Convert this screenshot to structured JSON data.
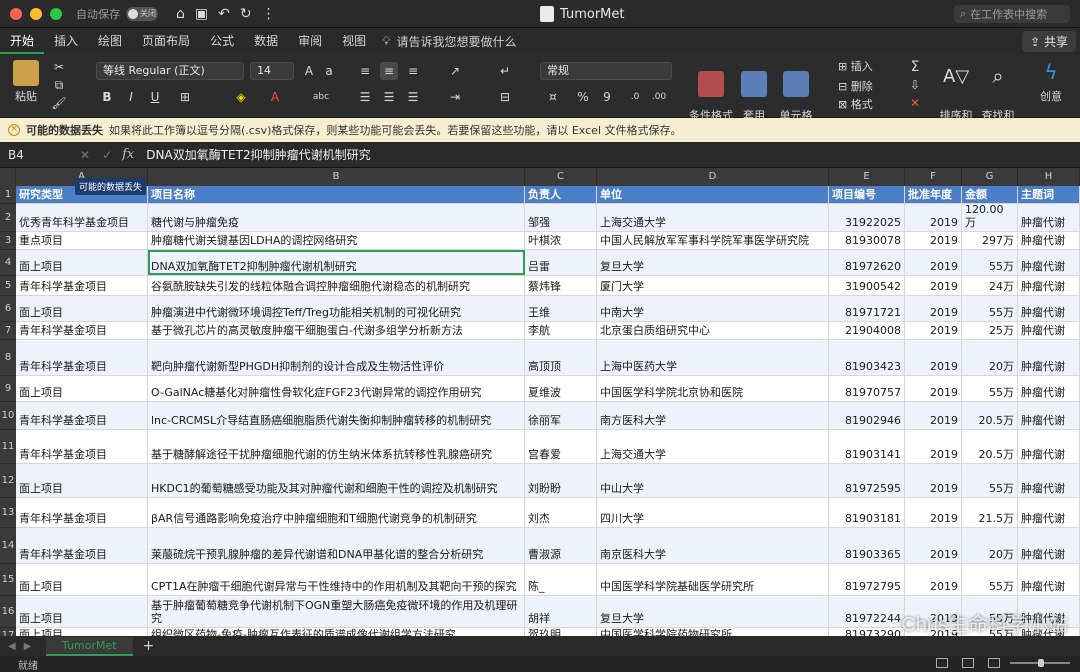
{
  "window": {
    "title": "TumorMet",
    "autosave_label": "自动保存",
    "autosave_state": "关闭",
    "search_placeholder": "在工作表中搜索"
  },
  "tabs": [
    "开始",
    "插入",
    "绘图",
    "页面布局",
    "公式",
    "数据",
    "审阅",
    "视图"
  ],
  "tell_me": "请告诉我您想要做什么",
  "share_label": "共享",
  "ribbon": {
    "paste_label": "粘贴",
    "font_name": "等线 Regular (正文)",
    "font_size": "14",
    "number_format": "常规",
    "conditional_format": "条件格式",
    "table_format": "套用\n表格格式",
    "cell_style": "单元格\n样式",
    "insert": "插入",
    "delete": "删除",
    "format": "格式",
    "sort_filter": "排序和\n筛选",
    "find_select": "查找和\n选择",
    "create": "创意"
  },
  "warning": {
    "title": "可能的数据丢失",
    "message": "如果将此工作簿以逗号分隔(.csv)格式保存，则某些功能可能会丢失。若要保留这些功能，请以 Excel 文件格式保存。"
  },
  "formula_bar": {
    "name_box": "B4",
    "formula": "DNA双加氧酶TET2抑制肿瘤代谢机制研究"
  },
  "tooltip": "可能的数据丢失",
  "columns": [
    "A",
    "B",
    "C",
    "D",
    "E",
    "F",
    "G",
    "H"
  ],
  "header": [
    "研究类型",
    "项目名称",
    "负责人",
    "单位",
    "项目编号",
    "批准年度",
    "金额",
    "主题词"
  ],
  "rows": [
    {
      "n": "2",
      "a": "优秀青年科学基金项目",
      "b": "糖代谢与肿瘤免疫",
      "c": "邹强",
      "d": "上海交通大学",
      "e": "31922025",
      "f": "2019",
      "g": "120.00万",
      "h": "肿瘤代谢"
    },
    {
      "n": "3",
      "a": "重点项目",
      "b": "肿瘤糖代谢关键基因LDHA的调控网络研究",
      "c": "叶棋浓",
      "d": "中国人民解放军军事科学院军事医学研究院",
      "e": "81930078",
      "f": "2019",
      "g": "297万",
      "h": "肿瘤代谢"
    },
    {
      "n": "4",
      "a": "面上项目",
      "b": "DNA双加氧酶TET2抑制肿瘤代谢机制研究",
      "c": "吕雷",
      "d": "复旦大学",
      "e": "81972620",
      "f": "2019",
      "g": "55万",
      "h": "肿瘤代谢"
    },
    {
      "n": "5",
      "a": "青年科学基金项目",
      "b": "谷氨酰胺缺失引发的线粒体融合调控肿瘤细胞代谢稳态的机制研究",
      "c": "蔡炜锋",
      "d": "厦门大学",
      "e": "31900542",
      "f": "2019",
      "g": "24万",
      "h": "肿瘤代谢"
    },
    {
      "n": "6",
      "a": "面上项目",
      "b": "肿瘤演进中代谢微环境调控Teff/Treg功能相关机制的可视化研究",
      "c": "王维",
      "d": "中南大学",
      "e": "81971721",
      "f": "2019",
      "g": "55万",
      "h": "肿瘤代谢"
    },
    {
      "n": "7",
      "a": "青年科学基金项目",
      "b": "基于微孔芯片的高灵敏度肿瘤干细胞蛋白-代谢多组学分析新方法",
      "c": "李航",
      "d": "北京蛋白质组研究中心",
      "e": "21904008",
      "f": "2019",
      "g": "25万",
      "h": "肿瘤代谢"
    },
    {
      "n": "8",
      "a": "青年科学基金项目",
      "b": "靶向肿瘤代谢新型PHGDH抑制剂的设计合成及生物活性评价",
      "c": "高顶顶",
      "d": "上海中医药大学",
      "e": "81903423",
      "f": "2019",
      "g": "20万",
      "h": "肿瘤代谢"
    },
    {
      "n": "9",
      "a": "面上项目",
      "b": "O-GalNAc糖基化对肿瘤性骨软化症FGF23代谢异常的调控作用研究",
      "c": "夏维波",
      "d": "中国医学科学院北京协和医院",
      "e": "81970757",
      "f": "2019",
      "g": "55万",
      "h": "肿瘤代谢"
    },
    {
      "n": "10",
      "a": "青年科学基金项目",
      "b": "lnc-CRCMSL介导结直肠癌细胞脂质代谢失衡抑制肿瘤转移的机制研究",
      "c": "徐丽军",
      "d": "南方医科大学",
      "e": "81902946",
      "f": "2019",
      "g": "20.5万",
      "h": "肿瘤代谢"
    },
    {
      "n": "11",
      "a": "青年科学基金项目",
      "b": "基于糖酵解途径干扰肿瘤细胞代谢的仿生纳米体系抗转移性乳腺癌研究",
      "c": "宫春爱",
      "d": "上海交通大学",
      "e": "81903141",
      "f": "2019",
      "g": "20.5万",
      "h": "肿瘤代谢"
    },
    {
      "n": "12",
      "a": "面上项目",
      "b": "HKDC1的葡萄糖感受功能及其对肿瘤代谢和细胞干性的调控及机制研究",
      "c": "刘盼盼",
      "d": "中山大学",
      "e": "81972595",
      "f": "2019",
      "g": "55万",
      "h": "肿瘤代谢"
    },
    {
      "n": "13",
      "a": "青年科学基金项目",
      "b": "βAR信号通路影响免疫治疗中肿瘤细胞和T细胞代谢竞争的机制研究",
      "c": "刘杰",
      "d": "四川大学",
      "e": "81903181",
      "f": "2019",
      "g": "21.5万",
      "h": "肿瘤代谢"
    },
    {
      "n": "14",
      "a": "青年科学基金项目",
      "b": "莱菔硫烷干预乳腺肿瘤的差异代谢谱和DNA甲基化谱的整合分析研究",
      "c": "曹淑源",
      "d": "南京医科大学",
      "e": "81903365",
      "f": "2019",
      "g": "20万",
      "h": "肿瘤代谢"
    },
    {
      "n": "15",
      "a": "面上项目",
      "b": "CPT1A在肿瘤干细胞代谢异常与干性维持中的作用机制及其靶向干预的探究",
      "c": "陈_",
      "d": "中国医学科学院基础医学研究所",
      "e": "81972795",
      "f": "2019",
      "g": "55万",
      "h": "肿瘤代谢"
    },
    {
      "n": "16",
      "a": "面上项目",
      "b": "基于肿瘤葡萄糖竞争代谢机制下OGN重塑大肠癌免疫微环境的作用及机理研究",
      "c": "胡祥",
      "d": "复旦大学",
      "e": "81972244",
      "f": "2019",
      "g": "55万",
      "h": "肿瘤代谢"
    },
    {
      "n": "17",
      "a": "面上项目",
      "b": "组织微区药物-免疫-肿瘤互作表征的质谱成像代谢组学方法研究",
      "c": "贺玖明",
      "d": "中国医学科学院药物研究所",
      "e": "81973290",
      "f": "2019",
      "g": "55万",
      "h": "肿瘤代谢"
    }
  ],
  "sheet_tab": "TumorMet",
  "status": "就绪",
  "watermark": "Chris生命科学小站"
}
